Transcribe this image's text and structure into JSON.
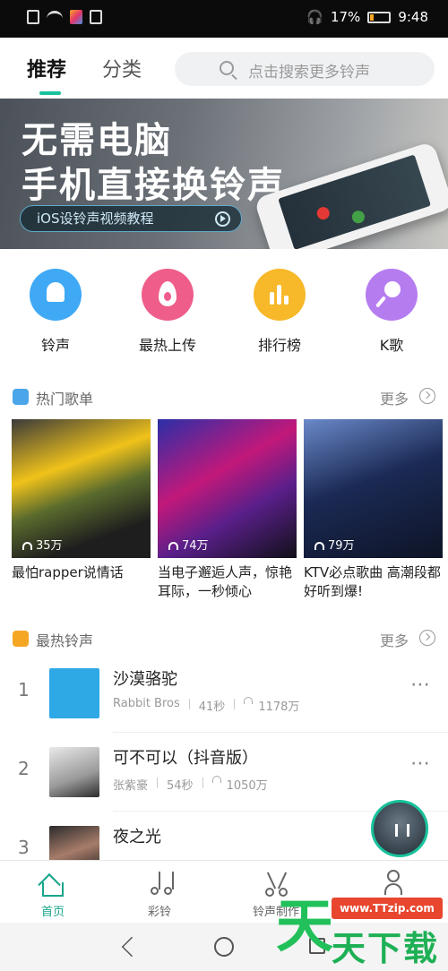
{
  "status_bar": {
    "battery": "17%",
    "time": "9:48",
    "battery_level": 0.17
  },
  "header": {
    "tabs": [
      {
        "label": "推荐",
        "active": true
      },
      {
        "label": "分类",
        "active": false
      }
    ],
    "search_placeholder": "点击搜索更多铃声"
  },
  "banner": {
    "line1": "无需电脑",
    "line2": "手机直接换铃声",
    "pill": "iOS设铃声视频教程"
  },
  "categories": [
    {
      "label": "铃声",
      "icon": "bell-icon",
      "color": "#3fa9f5"
    },
    {
      "label": "最热上传",
      "icon": "flame-icon",
      "color": "#ef5d8a"
    },
    {
      "label": "排行榜",
      "icon": "bar-chart-icon",
      "color": "#f7b829"
    },
    {
      "label": "K歌",
      "icon": "microphone-icon",
      "color": "#b57cf0"
    }
  ],
  "hot_playlists": {
    "title": "热门歌单",
    "more": "更多",
    "items": [
      {
        "count": "35万",
        "title": "最怕rapper说情话"
      },
      {
        "count": "74万",
        "title": "当电子邂逅人声，惊艳耳际，一秒倾心"
      },
      {
        "count": "79万",
        "title": "KTV必点歌曲 高潮段都好听到爆!"
      }
    ]
  },
  "hot_ringtones": {
    "title": "最热铃声",
    "more": "更多",
    "items": [
      {
        "rank": "1",
        "title": "沙漠骆驼",
        "artist": "Rabbit Bros",
        "duration": "41秒",
        "plays": "1178万"
      },
      {
        "rank": "2",
        "title": "可不可以（抖音版）",
        "artist": "张紫豪",
        "duration": "54秒",
        "plays": "1050万"
      },
      {
        "rank": "3",
        "title": "夜之光",
        "artist": "",
        "duration": "",
        "plays": ""
      }
    ]
  },
  "bottom_nav": [
    {
      "label": "首页",
      "icon": "home-icon",
      "active": true
    },
    {
      "label": "彩铃",
      "icon": "music-note-icon",
      "active": false
    },
    {
      "label": "铃声制作",
      "icon": "scissors-icon",
      "active": false
    },
    {
      "label": "我的",
      "icon": "user-icon",
      "active": false
    }
  ],
  "watermark": {
    "url": "www.TTzip.com",
    "text": "天下载",
    "big": "天"
  },
  "colors": {
    "accent": "#18c29c",
    "nav_active": "#18a58a"
  }
}
